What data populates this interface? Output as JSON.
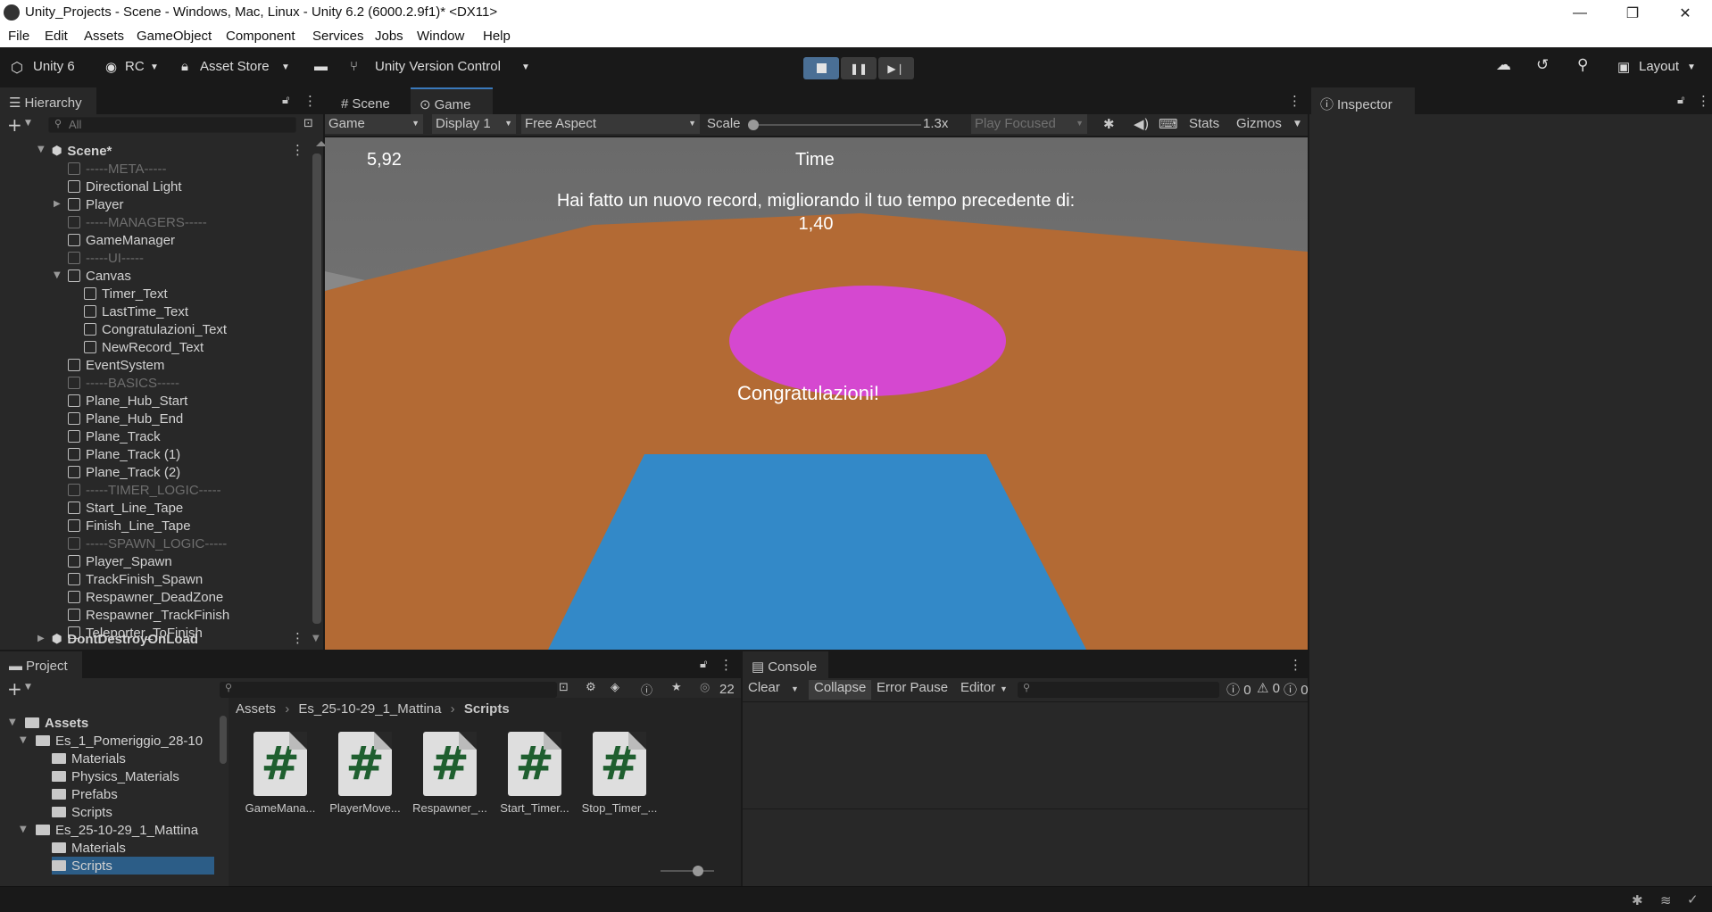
{
  "window": {
    "title": "Unity_Projects - Scene - Windows, Mac, Linux - Unity 6.2 (6000.2.9f1)* <DX11>",
    "minimize": "—",
    "restore": "❐",
    "close": "✕"
  },
  "menu": [
    "File",
    "Edit",
    "Assets",
    "GameObject",
    "Component",
    "Services",
    "Jobs",
    "Window",
    "Help"
  ],
  "toolbar": {
    "unity_label": "Unity 6",
    "account": "RC",
    "asset_store": "Asset Store",
    "version_control": "Unity Version Control",
    "layout": "Layout"
  },
  "hierarchy": {
    "tab": "Hierarchy",
    "search_placeholder": "All",
    "scene": "Scene*",
    "items": [
      {
        "label": "-----META-----",
        "sep": true
      },
      {
        "label": "Directional Light"
      },
      {
        "label": "Player"
      },
      {
        "label": "-----MANAGERS-----",
        "sep": true
      },
      {
        "label": "GameManager"
      },
      {
        "label": "-----UI-----",
        "sep": true
      },
      {
        "label": "Canvas"
      },
      {
        "label": "Timer_Text"
      },
      {
        "label": "LastTime_Text"
      },
      {
        "label": "Congratulazioni_Text"
      },
      {
        "label": "NewRecord_Text"
      },
      {
        "label": "EventSystem"
      },
      {
        "label": "-----BASICS-----",
        "sep": true
      },
      {
        "label": "Plane_Hub_Start"
      },
      {
        "label": "Plane_Hub_End"
      },
      {
        "label": "Plane_Track"
      },
      {
        "label": "Plane_Track (1)"
      },
      {
        "label": "Plane_Track (2)"
      },
      {
        "label": "-----TIMER_LOGIC-----",
        "sep": true
      },
      {
        "label": "Start_Line_Tape"
      },
      {
        "label": "Finish_Line_Tape"
      },
      {
        "label": "-----SPAWN_LOGIC-----",
        "sep": true
      },
      {
        "label": "Player_Spawn"
      },
      {
        "label": "TrackFinish_Spawn"
      },
      {
        "label": "Respawner_DeadZone"
      },
      {
        "label": "Respawner_TrackFinish"
      },
      {
        "label": "Teleporter_ToFinish"
      }
    ],
    "dont_destroy": "DontDestroyOnLoad"
  },
  "game": {
    "tab_scene": "Scene",
    "tab_game": "Game",
    "mode": "Game",
    "display": "Display 1",
    "aspect": "Free Aspect",
    "scale_label": "Scale",
    "scale_value": "1.3x",
    "play_focused": "Play Focused",
    "stats": "Stats",
    "gizmos": "Gizmos",
    "timer": "5,92",
    "time_label": "Time",
    "record_line1": "Hai fatto un nuovo record, migliorando il tuo tempo precedente di:",
    "record_line2": "1,40",
    "congrats": "Congratulazioni!"
  },
  "inspector": {
    "tab": "Inspector"
  },
  "project": {
    "tab": "Project",
    "breadcrumb": [
      "Assets",
      "Es_25-10-29_1_Mattina",
      "Scripts"
    ],
    "hidden_count": "22",
    "tree": [
      {
        "label": "Assets",
        "level": 0
      },
      {
        "label": "Es_1_Pomeriggio_28-10",
        "level": 1
      },
      {
        "label": "Materials",
        "level": 2
      },
      {
        "label": "Physics_Materials",
        "level": 2
      },
      {
        "label": "Prefabs",
        "level": 2
      },
      {
        "label": "Scripts",
        "level": 2
      },
      {
        "label": "Es_25-10-29_1_Mattina",
        "level": 1
      },
      {
        "label": "Materials",
        "level": 2
      },
      {
        "label": "Scripts",
        "level": 2
      }
    ],
    "files": [
      "GameMana...",
      "PlayerMove...",
      "Respawner_...",
      "Start_Timer...",
      "Stop_Timer_..."
    ]
  },
  "console": {
    "tab": "Console",
    "clear": "Clear",
    "collapse": "Collapse",
    "error_pause": "Error Pause",
    "editor": "Editor",
    "errors": "0",
    "warnings": "0",
    "infos": "0"
  },
  "colors": {
    "accent": "#3a79bb",
    "ground": "#b36a34",
    "sky": "#777777",
    "platform": "#d447cf",
    "track": "#3388c8"
  }
}
